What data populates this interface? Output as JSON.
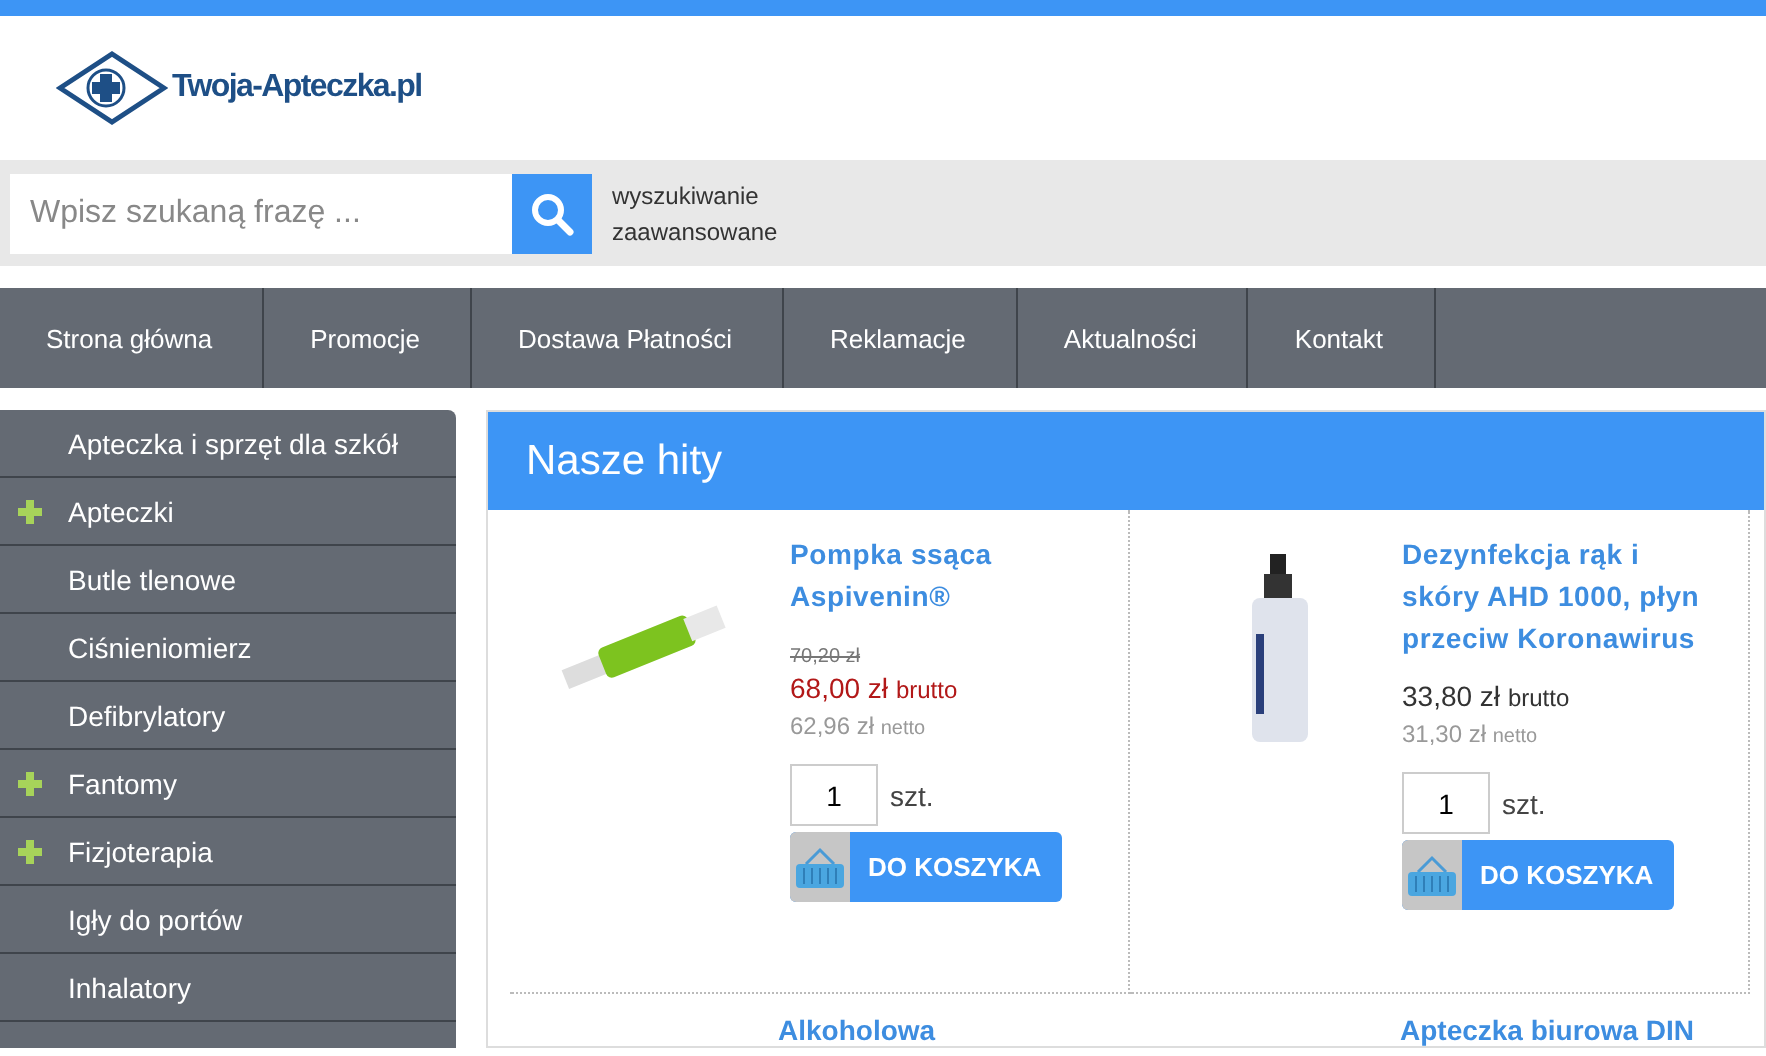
{
  "logo": {
    "text": "Twoja-Apteczka.pl"
  },
  "search": {
    "placeholder": "Wpisz szukaną frazę ...",
    "advanced_link": [
      "wyszukiwanie",
      "zaawansowane"
    ]
  },
  "nav": [
    "Strona główna",
    "Promocje",
    "Dostawa Płatności",
    "Reklamacje",
    "Aktualności",
    "Kontakt"
  ],
  "sidebar": {
    "items": [
      {
        "label": "Apteczka i sprzęt dla szkół",
        "expandable": false
      },
      {
        "label": "Apteczki",
        "expandable": true
      },
      {
        "label": "Butle tlenowe",
        "expandable": false
      },
      {
        "label": "Ciśnieniomierz",
        "expandable": false
      },
      {
        "label": "Defibrylatory",
        "expandable": false
      },
      {
        "label": "Fantomy",
        "expandable": true
      },
      {
        "label": "Fizjoterapia",
        "expandable": true
      },
      {
        "label": "Igły do portów",
        "expandable": false
      },
      {
        "label": "Inhalatory",
        "expandable": false
      }
    ]
  },
  "panel": {
    "title": "Nasze hity",
    "products": [
      {
        "kind": "syringe",
        "title": "Pompka ssąca Aspivenin®",
        "old_price": "70,20 zł",
        "price": "68,00 zł",
        "price_suffix": "brutto",
        "promo": true,
        "net_price": "62,96 zł",
        "net_suffix": "netto",
        "quantity": "1",
        "unit": "szt.",
        "button": "DO KOSZYKA"
      },
      {
        "kind": "bottle",
        "title": "Dezynfekcja rąk i skóry AHD 1000, płyn przeciw Koronawirus",
        "price": "33,80 zł",
        "price_suffix": "brutto",
        "promo": false,
        "net_price": "31,30 zł",
        "net_suffix": "netto",
        "quantity": "1",
        "unit": "szt.",
        "button": "DO KOSZYKA"
      }
    ],
    "next_titles": [
      "Alkoholowa",
      "Apteczka biurowa DIN"
    ]
  }
}
